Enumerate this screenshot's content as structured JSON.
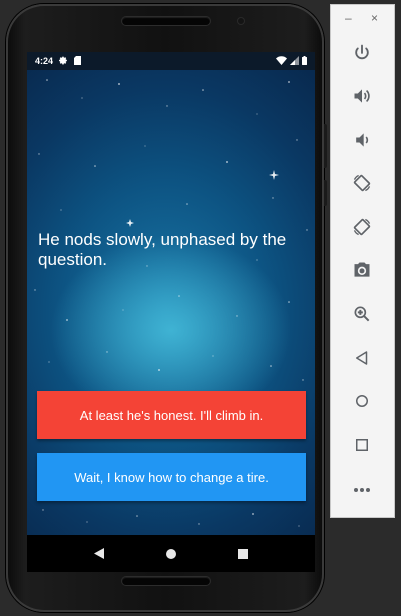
{
  "status_bar": {
    "time": "4:24",
    "left_icons": [
      "gear-icon",
      "sd-card-icon"
    ],
    "right_icons": [
      "wifi-icon",
      "signal-icon",
      "battery-icon"
    ]
  },
  "story": {
    "narration": "He nods slowly, unphased by the question."
  },
  "choices": [
    {
      "label": "At least he's honest. I'll climb in.",
      "color": "#f44336"
    },
    {
      "label": "Wait, I know how to change a tire.",
      "color": "#2196f3"
    }
  ],
  "nav": [
    "back-icon",
    "home-icon",
    "recents-icon"
  ],
  "emulator_toolbar": {
    "window_controls": {
      "minimize": "–",
      "close": "×"
    },
    "buttons": [
      "power-icon",
      "volume-up-icon",
      "volume-down-icon",
      "rotate-left-icon",
      "rotate-right-icon",
      "camera-icon",
      "zoom-icon",
      "back-icon",
      "home-icon",
      "overview-icon",
      "more-icon"
    ]
  }
}
